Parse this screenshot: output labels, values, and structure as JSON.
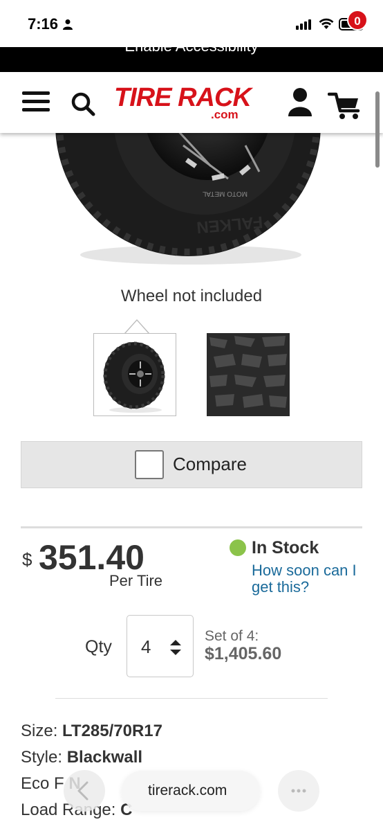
{
  "status_bar": {
    "time": "7:16"
  },
  "accessibility_bar": {
    "label": "Enable Accessibility"
  },
  "header": {
    "logo_main": "TIRE RACK",
    "logo_sub": ".com",
    "cart_count": "0",
    "icons": [
      "menu-icon",
      "search-icon",
      "account-icon",
      "cart-icon"
    ]
  },
  "product": {
    "image_caption": "Wheel not included",
    "rim_text": "MOTO METAL",
    "sidewall_text": "FALKEN",
    "compare_label": "Compare",
    "price_currency": "$",
    "price": "351.40",
    "price_unit": "Per Tire",
    "stock_status": "In Stock",
    "stock_color": "#8bc34a",
    "how_soon_link": "How soon can I get this?",
    "qty_label": "Qty",
    "qty_value": "4",
    "set_label": "Set of 4:",
    "set_price": "$1,405.60"
  },
  "specs": [
    {
      "label": "Size:",
      "value": "LT285/70R17"
    },
    {
      "label": "Style:",
      "value": "Blackwall"
    },
    {
      "label": "Eco F",
      "value": "N"
    },
    {
      "label": "Load Range:",
      "value": "C"
    }
  ],
  "browser": {
    "url": "tirerack.com"
  },
  "colors": {
    "brand_red": "#d7121a",
    "link_blue": "#1a6a9a"
  }
}
